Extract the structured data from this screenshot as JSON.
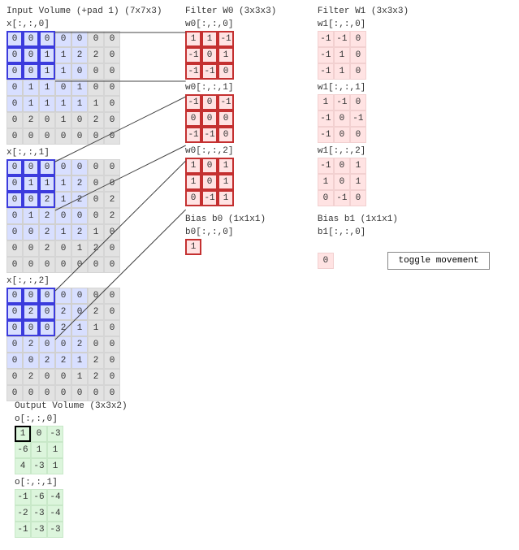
{
  "input": {
    "title": "Input Volume (+pad 1) (7x7x3)",
    "slices": [
      {
        "label": "x[:,:,0]",
        "data": [
          [
            0,
            0,
            0,
            0,
            0,
            0,
            0
          ],
          [
            0,
            0,
            1,
            1,
            2,
            2,
            0
          ],
          [
            0,
            0,
            1,
            1,
            0,
            0,
            0
          ],
          [
            0,
            1,
            1,
            0,
            1,
            0,
            0
          ],
          [
            0,
            1,
            1,
            1,
            1,
            1,
            0
          ],
          [
            0,
            2,
            0,
            1,
            0,
            2,
            0
          ],
          [
            0,
            0,
            0,
            0,
            0,
            0,
            0
          ]
        ]
      },
      {
        "label": "x[:,:,1]",
        "data": [
          [
            0,
            0,
            0,
            0,
            0,
            0,
            0
          ],
          [
            0,
            1,
            1,
            1,
            2,
            0,
            0
          ],
          [
            0,
            0,
            2,
            1,
            2,
            0,
            2
          ],
          [
            0,
            1,
            2,
            0,
            0,
            0,
            2
          ],
          [
            0,
            0,
            2,
            1,
            2,
            1,
            0
          ],
          [
            0,
            0,
            2,
            0,
            1,
            2,
            0
          ],
          [
            0,
            0,
            0,
            0,
            0,
            0,
            0
          ]
        ]
      },
      {
        "label": "x[:,:,2]",
        "data": [
          [
            0,
            0,
            0,
            0,
            0,
            0,
            0
          ],
          [
            0,
            2,
            0,
            2,
            0,
            2,
            0
          ],
          [
            0,
            0,
            0,
            2,
            1,
            1,
            0
          ],
          [
            0,
            2,
            0,
            0,
            2,
            0,
            0
          ],
          [
            0,
            0,
            2,
            2,
            1,
            2,
            0
          ],
          [
            0,
            2,
            0,
            0,
            1,
            2,
            0
          ],
          [
            0,
            0,
            0,
            0,
            0,
            0,
            0
          ]
        ]
      }
    ],
    "highlight_rows": 3,
    "highlight_cols": 3
  },
  "filter0": {
    "title": "Filter W0 (3x3x3)",
    "slices": [
      {
        "label": "w0[:,:,0]",
        "data": [
          [
            1,
            1,
            -1
          ],
          [
            -1,
            0,
            1
          ],
          [
            -1,
            -1,
            0
          ]
        ]
      },
      {
        "label": "w0[:,:,1]",
        "data": [
          [
            -1,
            0,
            -1
          ],
          [
            0,
            0,
            0
          ],
          [
            -1,
            -1,
            0
          ]
        ]
      },
      {
        "label": "w0[:,:,2]",
        "data": [
          [
            1,
            0,
            1
          ],
          [
            1,
            0,
            1
          ],
          [
            0,
            -1,
            1
          ]
        ]
      }
    ],
    "bias": {
      "label": "Bias b0 (1x1x1)",
      "sub": "b0[:,:,0]",
      "value": 1
    }
  },
  "filter1": {
    "title": "Filter W1 (3x3x3)",
    "slices": [
      {
        "label": "w1[:,:,0]",
        "data": [
          [
            -1,
            -1,
            0
          ],
          [
            -1,
            1,
            0
          ],
          [
            -1,
            1,
            0
          ]
        ]
      },
      {
        "label": "w1[:,:,1]",
        "data": [
          [
            1,
            -1,
            0
          ],
          [
            -1,
            0,
            -1
          ],
          [
            -1,
            0,
            0
          ]
        ]
      },
      {
        "label": "w1[:,:,2]",
        "data": [
          [
            -1,
            0,
            1
          ],
          [
            1,
            0,
            1
          ],
          [
            0,
            -1,
            0
          ]
        ]
      }
    ],
    "bias": {
      "label": "Bias b1 (1x1x1)",
      "sub": "b1[:,:,0]",
      "value": 0
    }
  },
  "output": {
    "title": "Output Volume (3x3x2)",
    "slices": [
      {
        "label": "o[:,:,0]",
        "data": [
          [
            1,
            0,
            -3
          ],
          [
            -6,
            1,
            1
          ],
          [
            4,
            -3,
            1
          ]
        ]
      },
      {
        "label": "o[:,:,1]",
        "data": [
          [
            -1,
            -6,
            -4
          ],
          [
            -2,
            -3,
            -4
          ],
          [
            -1,
            -3,
            -3
          ]
        ]
      }
    ]
  },
  "button": {
    "label": "toggle movement"
  }
}
